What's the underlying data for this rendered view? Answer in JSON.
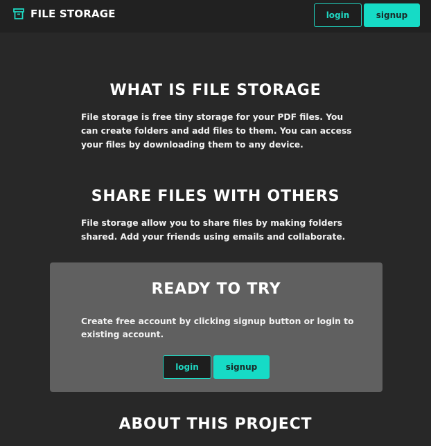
{
  "header": {
    "brand_title": "FILE STORAGE",
    "brand_icon": "archive-box-icon",
    "login_label": "login",
    "signup_label": "signup"
  },
  "sections": {
    "what": {
      "heading": "WHAT IS FILE STORAGE",
      "body": "File storage is free tiny storage for your PDF files. You can create folders and add files to them. You can access your files by downloading them to any device."
    },
    "share": {
      "heading": "SHARE FILES WITH OTHERS",
      "body": "File storage allow you to share files by making folders shared. Add your friends using emails and collaborate."
    },
    "try": {
      "heading": "READY TO TRY",
      "body": "Create free account by clicking signup button or login to existing account.",
      "login_label": "login",
      "signup_label": "signup"
    },
    "about": {
      "heading": "ABOUT THIS PROJECT"
    }
  },
  "colors": {
    "accent": "#16dbc6",
    "background": "#282828",
    "header_background": "#212121",
    "card_background": "#606060"
  }
}
